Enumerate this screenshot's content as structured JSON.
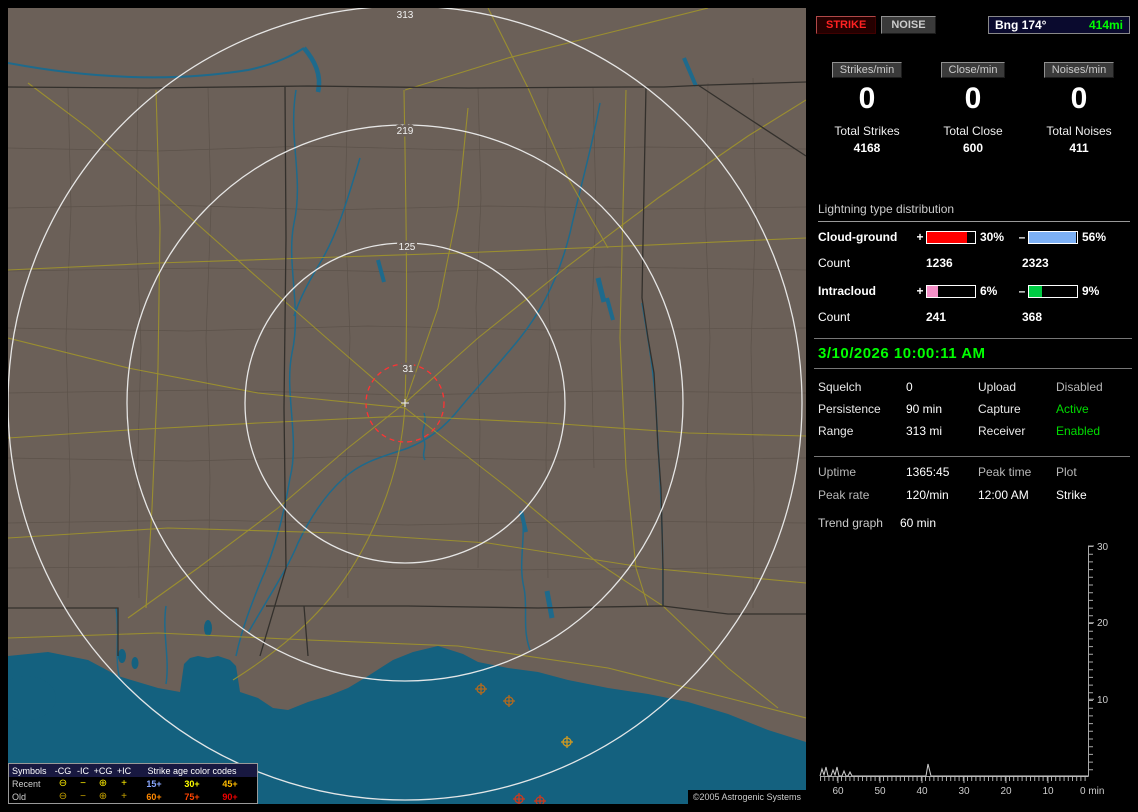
{
  "map": {
    "ring_labels": [
      "313",
      "219",
      "125",
      "31"
    ],
    "copyright": "©2005 Astrogenic Systems",
    "legend": {
      "symbols_header": "Symbols",
      "symbol_cols": [
        "-CG",
        "-IC",
        "+CG",
        "+IC"
      ],
      "age_header": "Strike age color codes",
      "rows": [
        {
          "label": "Recent",
          "symbols": [
            "⊖",
            "−",
            "⊕",
            "+"
          ],
          "symbol_color": "#ffee00",
          "ages": [
            {
              "text": "15+",
              "color": "#8aa8ff"
            },
            {
              "text": "30+",
              "color": "#ffff00"
            },
            {
              "text": "45+",
              "color": "#ffbb00"
            }
          ]
        },
        {
          "label": "Old",
          "symbols": [
            "⊖",
            "−",
            "⊕",
            "+"
          ],
          "symbol_color": "#c8a400",
          "ages": [
            {
              "text": "60+",
              "color": "#ff8800"
            },
            {
              "text": "75+",
              "color": "#ff4400"
            },
            {
              "text": "90+",
              "color": "#ee0000"
            }
          ]
        }
      ]
    }
  },
  "panel": {
    "strike_button": "STRIKE",
    "noise_button": "NOISE",
    "bearing_label": "Bng 174°",
    "distance": "414mi",
    "rates": [
      {
        "label": "Strikes/min",
        "value": "0",
        "total_label": "Total Strikes",
        "total": "4168"
      },
      {
        "label": "Close/min",
        "value": "0",
        "total_label": "Total Close",
        "total": "600"
      },
      {
        "label": "Noises/min",
        "value": "0",
        "total_label": "Total Noises",
        "total": "411"
      }
    ],
    "distribution": {
      "title": "Lightning type distribution",
      "count_label": "Count",
      "plus": "+",
      "minus": "–",
      "rows": [
        {
          "label": "Cloud-ground",
          "pos_pct": "30%",
          "neg_pct": "56%",
          "pos_count": "1236",
          "neg_count": "2323",
          "pos_color": "#ff0000",
          "neg_color": "#7cb0f5",
          "pos_fill": 84,
          "neg_fill": 97
        },
        {
          "label": "Intracloud",
          "pos_pct": "6%",
          "neg_pct": "9%",
          "pos_count": "241",
          "neg_count": "368",
          "pos_color": "#f590c8",
          "neg_color": "#00cc44",
          "pos_fill": 22,
          "neg_fill": 28
        }
      ]
    },
    "datetime": "3/10/2026 10:00:11 AM",
    "settings": [
      {
        "k1": "Squelch",
        "v1": "0",
        "k2": "Upload",
        "v2": "Disabled",
        "v2_color": "#b8b8b8"
      },
      {
        "k1": "Persistence",
        "v1": "90 min",
        "k2": "Capture",
        "v2": "Active",
        "v2_color": "#00dd00"
      },
      {
        "k1": "Range",
        "v1": "313 mi",
        "k2": "Receiver",
        "v2": "Enabled",
        "v2_color": "#00dd00"
      }
    ],
    "stats": {
      "r1": [
        "Uptime",
        "1365:45",
        "Peak time",
        "Plot"
      ],
      "r2": [
        "Peak rate",
        "120/min",
        "12:00 AM",
        "Strike"
      ]
    },
    "trend": {
      "label": "Trend graph",
      "window": "60 min",
      "y_ticks": [
        "30",
        "20",
        "10"
      ],
      "x_ticks": [
        "60",
        "50",
        "40",
        "30",
        "20",
        "10",
        "0 min"
      ]
    }
  }
}
